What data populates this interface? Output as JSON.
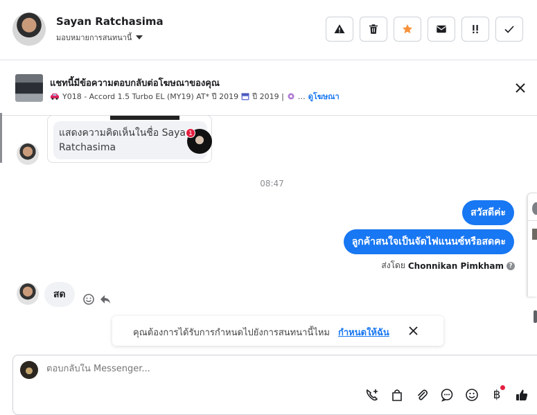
{
  "header": {
    "name": "Sayan Ratchasima",
    "assign_label": "มอบหมายการสนทนานี้",
    "actions": [
      "spam",
      "delete",
      "star",
      "unread",
      "priority",
      "done"
    ],
    "star_color": "#f7923b"
  },
  "ad": {
    "title": "แชทนี้มีข้อความตอบกลับต่อโฆษณาของคุณ",
    "subtitle": "Y018 - Accord 1.5 Turbo EL (MY19) AT* ปี 2019",
    "subtitle_year": "ปี 2019 |",
    "ellipsis": "…",
    "link": "ดูโฆษณา"
  },
  "messages": {
    "comment_text": "แสดงความคิดเห็นในชื่อ Sayan Ratchasima",
    "comment_badge": "1",
    "time": "08:47",
    "outgoing": [
      "สวัสดีค่ะ",
      "ลูกค้าสนใจเป็นจัดไฟแนนซ์หรือสดคะ"
    ],
    "sent_by_label": "ส่งโดย",
    "sent_by_name": "Chonnikan Pimkham",
    "incoming": "สด"
  },
  "assign_banner": {
    "text": "คุณต้องการได้รับการกำหนดไปยังการสนทนานี้ไหม",
    "link": "กำหนดให้ฉัน"
  },
  "composer": {
    "placeholder": "ตอบกลับใน Messenger...",
    "tools": [
      "call-add",
      "shop",
      "attach",
      "saved-reply",
      "emoji",
      "payment",
      "like"
    ],
    "payment_symbol": "฿"
  },
  "colors": {
    "accent": "#1877f2",
    "bubble_in": "#f0f2f5",
    "badge_red": "#e41e3f"
  }
}
